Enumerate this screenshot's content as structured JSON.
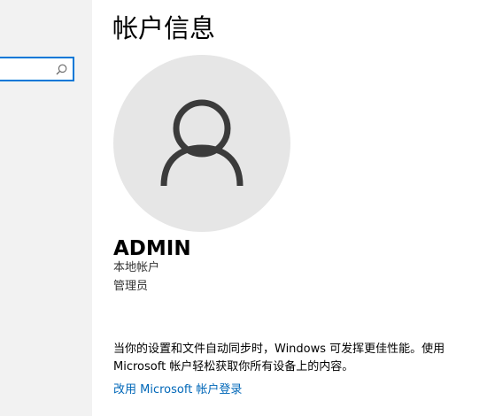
{
  "page": {
    "title": "帐户信息"
  },
  "sidebar": {
    "search": {
      "value": "",
      "placeholder": ""
    }
  },
  "account": {
    "avatar_icon": "person-icon",
    "name": "ADMIN",
    "type": "本地帐户",
    "role": "管理员"
  },
  "sync": {
    "description": "当你的设置和文件自动同步时，Windows 可发挥更佳性能。使用 Microsoft 帐户轻松获取你所有设备上的内容。",
    "link_label": "改用 Microsoft 帐户登录"
  },
  "colors": {
    "accent": "#0078d7",
    "link": "#0067b8",
    "sidebar_bg": "#f2f2f2",
    "avatar_bg": "#e6e6e6"
  }
}
